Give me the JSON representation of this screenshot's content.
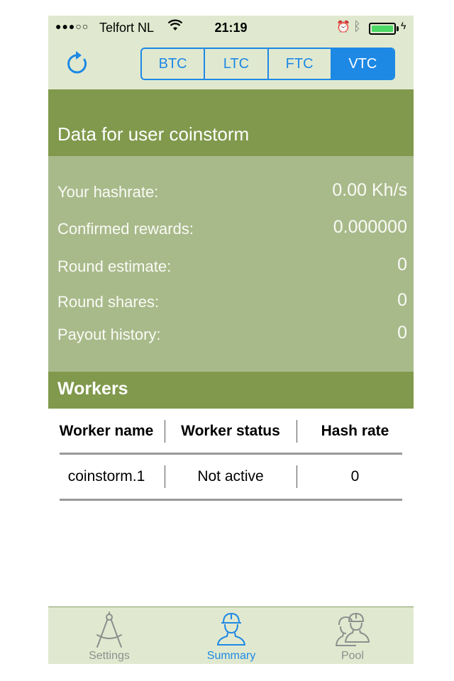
{
  "status_bar": {
    "signal": "●●●○○",
    "carrier": "Telfort NL",
    "time": "21:19"
  },
  "nav": {
    "refresh_icon": "refresh-icon",
    "segments": [
      {
        "label": "BTC",
        "active": false
      },
      {
        "label": "LTC",
        "active": false
      },
      {
        "label": "FTC",
        "active": false
      },
      {
        "label": "VTC",
        "active": true
      }
    ]
  },
  "user_section": {
    "title": "Data for user coinstorm",
    "stats": [
      {
        "label": "Your hashrate:",
        "value": "0.00 Kh/s"
      },
      {
        "label": "Confirmed rewards:",
        "value": "0.000000"
      },
      {
        "label": "Round estimate:",
        "value": "0"
      },
      {
        "label": "Round shares:",
        "value": "0"
      },
      {
        "label": "Payout history:",
        "value": "0"
      }
    ]
  },
  "workers": {
    "title": "Workers",
    "columns": [
      "Worker name",
      "Worker status",
      "Hash rate"
    ],
    "rows": [
      {
        "name": "coinstorm.1",
        "status": "Not active",
        "hashrate": "0"
      }
    ]
  },
  "tabbar": {
    "tabs": [
      {
        "label": "Settings",
        "icon": "compass-icon",
        "active": false
      },
      {
        "label": "Summary",
        "icon": "worker-icon",
        "active": true
      },
      {
        "label": "Pool",
        "icon": "workers-group-icon",
        "active": false
      }
    ]
  },
  "colors": {
    "accent": "#1e88e5",
    "header_green": "#80994c",
    "panel_green": "#a8ba8a",
    "bar_background": "#e0e9cf"
  }
}
